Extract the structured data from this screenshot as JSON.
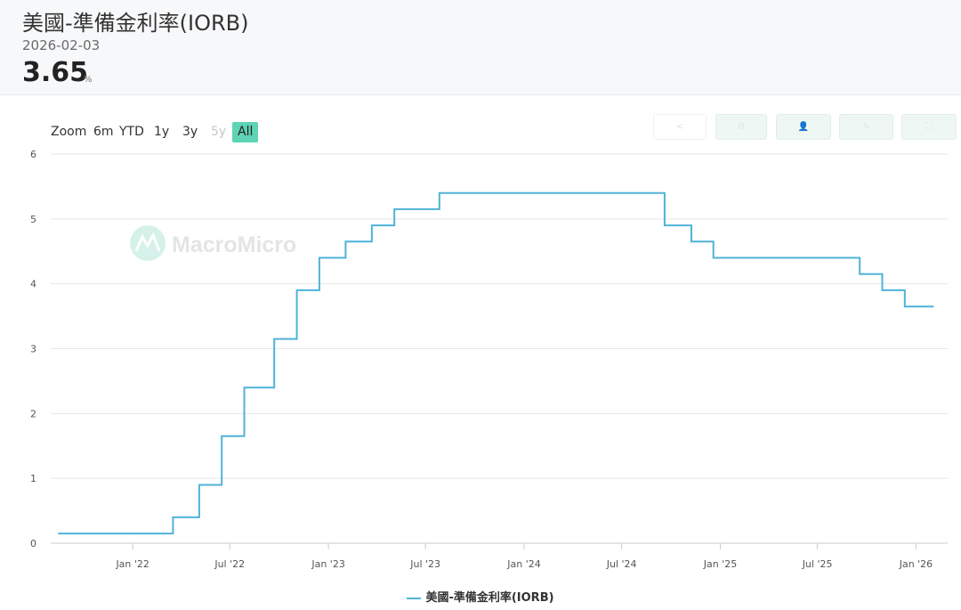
{
  "header": {
    "title": "美國-準備金利率(IORB)",
    "date": "2026-02-03",
    "value": "3.65",
    "unit": "%"
  },
  "range_selector": {
    "zoom_label": "Zoom",
    "buttons": [
      {
        "label": "6m",
        "state": "normal"
      },
      {
        "label": "YTD",
        "state": "normal"
      },
      {
        "label": "1y",
        "state": "normal"
      },
      {
        "label": "3y",
        "state": "normal"
      },
      {
        "label": "5y",
        "state": "disabled"
      },
      {
        "label": "All",
        "state": "active"
      }
    ]
  },
  "watermark": "MacroMicro",
  "colors": {
    "line": "#4fb3d9",
    "active_range": "#5fd3b5"
  },
  "chart_data": {
    "type": "line",
    "step": true,
    "title": "美國-準備金利率(IORB)",
    "xlabel": "",
    "ylabel": "",
    "ylim": [
      0,
      6
    ],
    "xlim": [
      "2021-08-01",
      "2026-03-01"
    ],
    "y_ticks": [
      "0",
      "1",
      "2",
      "3",
      "4",
      "5",
      "6"
    ],
    "x_ticks": [
      {
        "label": "Jan '22",
        "date": "2022-01-01"
      },
      {
        "label": "Jul '22",
        "date": "2022-07-01"
      },
      {
        "label": "Jan '23",
        "date": "2023-01-01"
      },
      {
        "label": "Jul '23",
        "date": "2023-07-01"
      },
      {
        "label": "Jan '24",
        "date": "2024-01-01"
      },
      {
        "label": "Jul '24",
        "date": "2024-07-01"
      },
      {
        "label": "Jan '25",
        "date": "2025-01-01"
      },
      {
        "label": "Jul '25",
        "date": "2025-07-01"
      },
      {
        "label": "Jan '26",
        "date": "2026-01-01"
      }
    ],
    "grid": true,
    "legend": "bottom-center",
    "series": [
      {
        "name": "美國-準備金利率(IORB)",
        "points": [
          [
            "2021-08-15",
            0.15
          ],
          [
            "2022-03-17",
            0.4
          ],
          [
            "2022-05-05",
            0.9
          ],
          [
            "2022-06-16",
            1.65
          ],
          [
            "2022-07-28",
            2.4
          ],
          [
            "2022-09-22",
            3.15
          ],
          [
            "2022-11-03",
            3.9
          ],
          [
            "2022-12-15",
            4.4
          ],
          [
            "2023-02-02",
            4.65
          ],
          [
            "2023-03-23",
            4.9
          ],
          [
            "2023-05-04",
            5.15
          ],
          [
            "2023-07-27",
            5.4
          ],
          [
            "2024-09-19",
            4.9
          ],
          [
            "2024-11-08",
            4.65
          ],
          [
            "2024-12-19",
            4.4
          ],
          [
            "2025-09-18",
            4.15
          ],
          [
            "2025-10-30",
            3.9
          ],
          [
            "2025-12-11",
            3.65
          ],
          [
            "2026-02-03",
            3.65
          ]
        ]
      }
    ]
  }
}
